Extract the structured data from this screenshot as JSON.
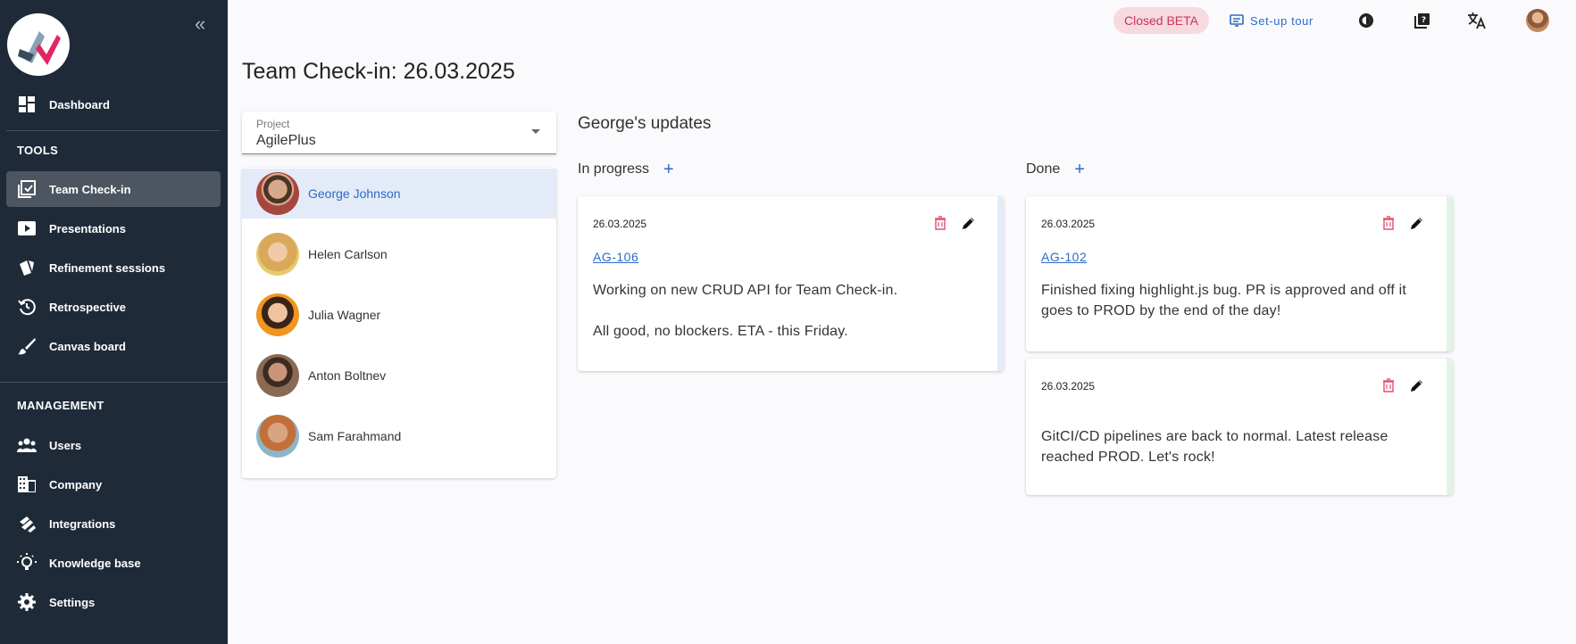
{
  "sidebar": {
    "items_top": [
      {
        "label": "Dashboard",
        "icon": "dashboard-icon"
      }
    ],
    "sections": [
      {
        "title": "TOOLS",
        "items": [
          {
            "label": "Team Check-in",
            "icon": "checkin-icon",
            "active": true
          },
          {
            "label": "Presentations",
            "icon": "video-icon"
          },
          {
            "label": "Refinement sessions",
            "icon": "cards-icon"
          },
          {
            "label": "Retrospective",
            "icon": "history-icon"
          },
          {
            "label": "Canvas board",
            "icon": "brush-icon"
          }
        ]
      },
      {
        "title": "MANAGEMENT",
        "items": [
          {
            "label": "Users",
            "icon": "users-icon"
          },
          {
            "label": "Company",
            "icon": "building-icon"
          },
          {
            "label": "Integrations",
            "icon": "integrations-icon"
          },
          {
            "label": "Knowledge base",
            "icon": "lightbulb-icon"
          },
          {
            "label": "Settings",
            "icon": "gear-icon"
          }
        ]
      }
    ]
  },
  "topbar": {
    "beta_label": "Closed BETA",
    "tour_label": "Set-up tour",
    "icons": [
      "theme-icon",
      "help-icon",
      "translate-icon"
    ]
  },
  "page": {
    "title": "Team Check-in: 26.03.2025"
  },
  "project_select": {
    "label": "Project",
    "value": "AgilePlus"
  },
  "members": [
    {
      "name": "George Johnson",
      "selected": true
    },
    {
      "name": "Helen Carlson"
    },
    {
      "name": "Julia Wagner"
    },
    {
      "name": "Anton Boltnev"
    },
    {
      "name": "Sam Farahmand"
    }
  ],
  "updates": {
    "title": "George's updates",
    "columns": [
      {
        "title": "In progress",
        "accent": "#e3ebf8",
        "cards": [
          {
            "date": "26.03.2025",
            "key": "AG-106",
            "lines": [
              "Working on new CRUD API for Team Check-in.",
              "All good, no blockers. ETA - this Friday."
            ]
          }
        ]
      },
      {
        "title": "Done",
        "accent": "#e3f4e6",
        "cards": [
          {
            "date": "26.03.2025",
            "key": "AG-102",
            "lines": [
              "Finished fixing highlight.js bug. PR is approved and off it",
              "goes to PROD by the end of the day!"
            ]
          },
          {
            "date": "26.03.2025",
            "key": "",
            "lines": [
              "GitCI/CD pipelines are back to normal. Latest release",
              "reached PROD. Let's rock!"
            ]
          }
        ]
      }
    ]
  },
  "colors": {
    "sidebar_bg": "#1f2a38",
    "accent_blue": "#2c6bc8",
    "delete_red": "#e05070",
    "beta_bg": "#f7d9e0"
  }
}
